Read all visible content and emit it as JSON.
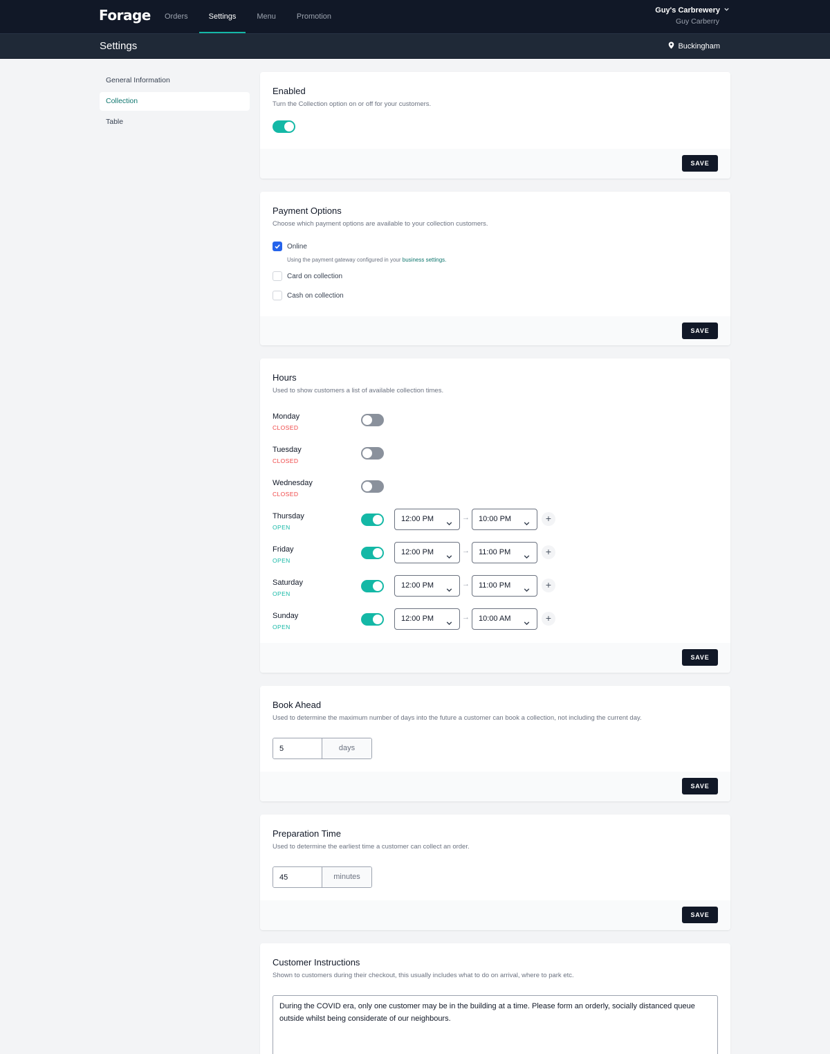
{
  "app": {
    "logo": "Forage"
  },
  "nav": {
    "orders": "Orders",
    "settings": "Settings",
    "menu": "Menu",
    "promotion": "Promotion"
  },
  "account": {
    "business": "Guy's Carbrewery",
    "user": "Guy Carberry"
  },
  "header": {
    "title": "Settings",
    "location": "Buckingham"
  },
  "sidebar": {
    "items": [
      {
        "label": "General Information"
      },
      {
        "label": "Collection"
      },
      {
        "label": "Table"
      }
    ]
  },
  "save_label": "SAVE",
  "enabled": {
    "title": "Enabled",
    "desc": "Turn the Collection option on or off for your customers.",
    "on": true
  },
  "payment": {
    "title": "Payment Options",
    "desc": "Choose which payment options are available to your collection customers.",
    "online": "Online",
    "online_help": "Using the payment gateway configured in your",
    "online_help_link": "business settings.",
    "card": "Card on collection",
    "cash": "Cash on collection"
  },
  "hours": {
    "title": "Hours",
    "desc": "Used to show customers a list of available collection times.",
    "days": [
      {
        "name": "Monday",
        "status": "CLOSED"
      },
      {
        "name": "Tuesday",
        "status": "CLOSED"
      },
      {
        "name": "Wednesday",
        "status": "CLOSED"
      },
      {
        "name": "Thursday",
        "status": "OPEN",
        "from": "12:00 PM",
        "to": "10:00 PM"
      },
      {
        "name": "Friday",
        "status": "OPEN",
        "from": "12:00 PM",
        "to": "11:00 PM"
      },
      {
        "name": "Saturday",
        "status": "OPEN",
        "from": "12:00 PM",
        "to": "11:00 PM"
      },
      {
        "name": "Sunday",
        "status": "OPEN",
        "from": "12:00 PM",
        "to": "10:00 AM"
      }
    ]
  },
  "book_ahead": {
    "title": "Book Ahead",
    "desc": "Used to determine the maximum number of days into the future a customer can book a collection, not including the current day.",
    "value": "5",
    "unit": "days"
  },
  "prep": {
    "title": "Preparation Time",
    "desc": "Used to determine the earliest time a customer can collect an order.",
    "value": "45",
    "unit": "minutes"
  },
  "instructions": {
    "title": "Customer Instructions",
    "desc": "Shown to customers during their checkout, this usually includes what to do on arrival, where to park etc.",
    "value": "During the COVID era, only one customer may be in the building at a time. Please form an orderly, socially distanced queue outside whilst being considerate of our neighbours."
  },
  "colors": {
    "accent": "#14b8a6",
    "nav_bg": "#111827",
    "closed": "#ef4444",
    "checkbox": "#2563eb"
  }
}
